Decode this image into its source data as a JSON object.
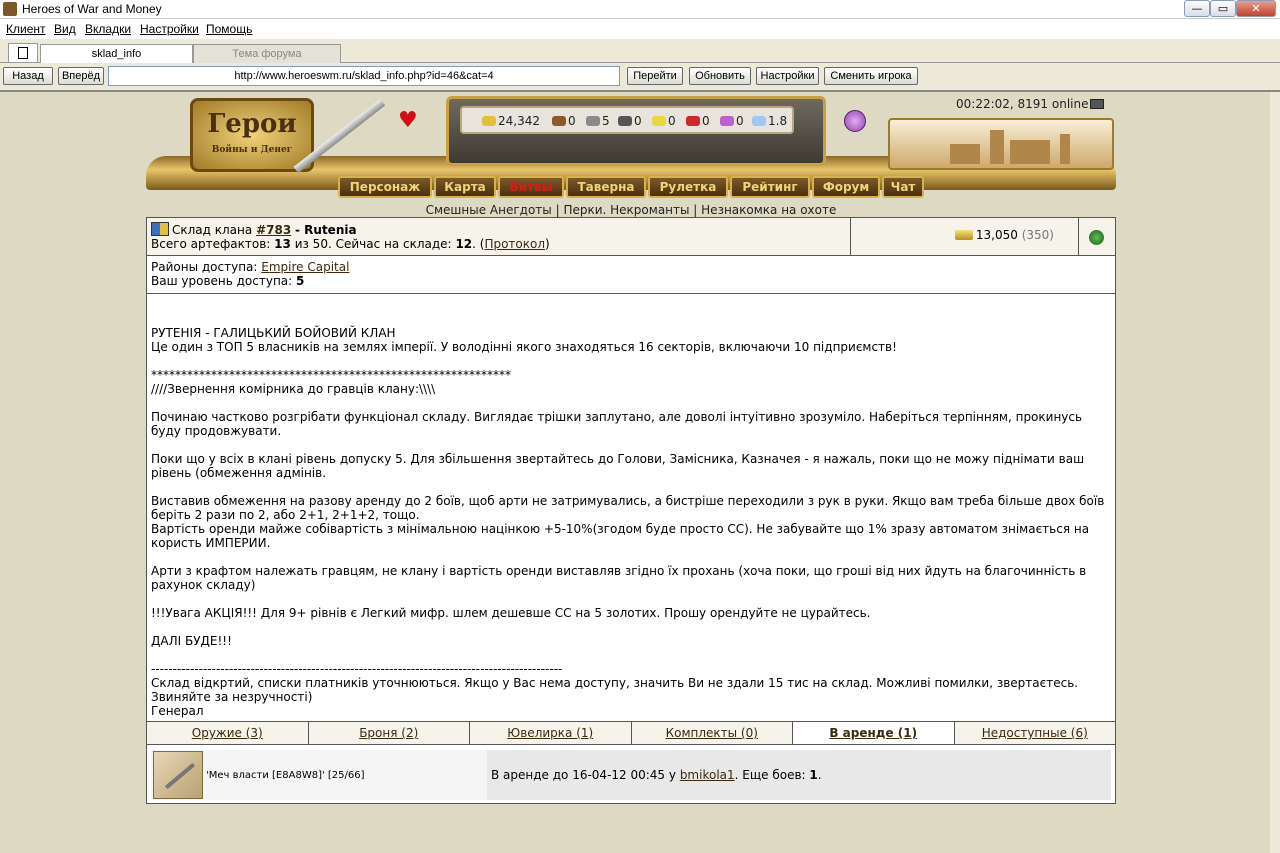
{
  "window": {
    "title": "Heroes of War and Money",
    "minimize": "—",
    "maximize": "▭",
    "close": "✕"
  },
  "menu": [
    "Клиент",
    "Вид",
    "Вкладки",
    "Настройки",
    "Помощь"
  ],
  "tabs": [
    {
      "label": "sklad_info"
    },
    {
      "label": "Тема форума"
    }
  ],
  "toolbar": {
    "back": "Назад",
    "forward": "Вперёд",
    "url": "http://www.heroeswm.ru/sklad_info.php?id=46&cat=4",
    "go": "Перейти",
    "refresh": "Обновить",
    "settings": "Настройки",
    "switch_player": "Сменить игрока"
  },
  "game": {
    "logo_title": "Герои",
    "logo_subtitle": "Войны и Денег",
    "clock": "00:22:02, 8191 online",
    "resources": [
      "24,342",
      "0",
      "5",
      "0",
      "0",
      "0",
      "0",
      "1.8"
    ],
    "nav": [
      "Персонаж",
      "Карта",
      "Битвы",
      "Таверна",
      "Рулетка",
      "Рейтинг",
      "Форум",
      "Чат"
    ],
    "jokes": [
      "Смешные Анегдоты",
      "Перки. Некроманты",
      "Незнакомка на охоте"
    ]
  },
  "sklad": {
    "clan_prefix": "Склад клана",
    "clan_id": "#783",
    "clan_name": "- Rutenia",
    "total_label": "Всего артефактов:",
    "total": "13",
    "of": "из 50. Сейчас на складе:",
    "now": "12",
    "protocol": "Протокол",
    "gold": "13,050",
    "gold_extra": "(350)",
    "districts_label": "Районы доступа:",
    "district": "Empire Capital",
    "level_label": "Ваш уровень доступа:",
    "level": "5"
  },
  "description": [
    "",
    "РУТЕНІЯ - ГАЛИЦЬКИЙ БОЙОВИЙ КЛАН",
    "Це один з ТОП 5 власників на землях імперії. У володінні якого знаходяться 16 секторів, включаючи 10 підприємств!",
    "",
    "************************************************************",
    "////Звернення комірника до гравців клану:\\\\\\\\",
    "",
    "Починаю частково розгрібати функціонал складу. Виглядає трішки заплутано, але доволі інтуітивно зрозуміло. Наберіться терпінням, прокинусь буду продовжувати.",
    "",
    "Поки що у всіх в клані рівень допуску 5. Для збільшення звертайтесь до Голови, Замісника, Казначея - я нажаль, поки що не можу піднімати ваш рівень (обмеження адмінів.",
    "",
    "Виставив обмеження на разову аренду до 2 боїв, щоб арти не затримувались, а бистріше переходили з рук в руки. Якщо вам треба більше двох боїв беріть 2 рази по 2, або 2+1, 2+1+2, тощо.",
    "Вартість оренди майже собівартість з мінімальною націнкою +5-10%(згодом буде просто СС). Не забувайте що 1% зразу автоматом знімається на користь ИМПЕРИИ.",
    "",
    "Арти з крафтом належать гравцям, не клану і вартість оренди виставляв згідно їх прохань (хоча поки, що гроші від них йдуть на благочинність в рахунок складу)",
    "",
    "!!!Увага АКЦІЯ!!! Для 9+ рівнів є Легкий мифр. шлем дешевше СС на 5 золотих. Прошу орендуйте не цурайтесь.",
    "",
    "ДАЛІ БУДЕ!!!",
    "",
    "-----------------------------------------------------------------------------------------------",
    "Склад відкртий, списки платників уточнюються. Якщо у Вас нема доступу, значить Ви не здали 15 тис на склад. Можливі помилки, звертаєтесь. Звиняйте за незручності)",
    "Генерал"
  ],
  "categories": [
    "Оружие (3)",
    "Броня (2)",
    "Ювелирка (1)",
    "Комплекты (0)",
    "В аренде (1)",
    "Недоступные (6)"
  ],
  "rented_item": {
    "name": "'Меч власти [E8A8W8]' [25/66]",
    "rent_prefix": "В аренде до 16-04-12 00:45 у",
    "renter": "bmikola1",
    "battles_label": ". Еще боев:",
    "battles": "1",
    "end": "."
  },
  "colors": {
    "nav_active": "#e01818",
    "nav_text": "#f2d27a",
    "link": "#3a2a10"
  }
}
